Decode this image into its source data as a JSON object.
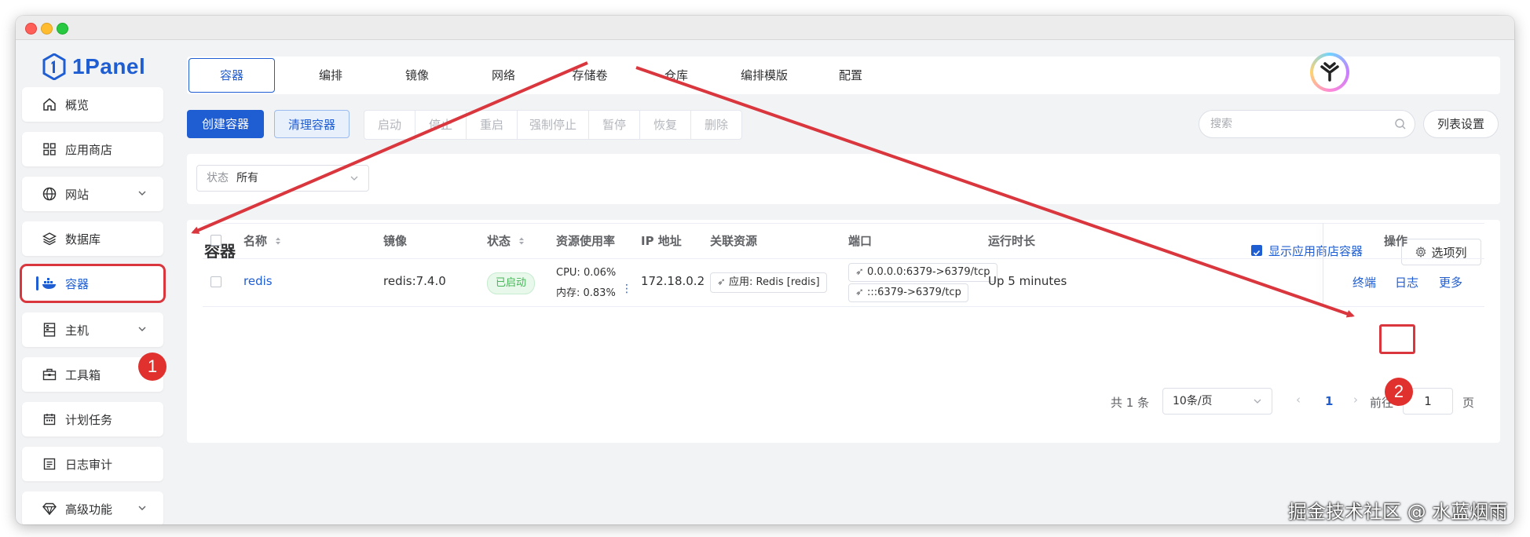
{
  "app": {
    "logo": "1Panel"
  },
  "sidebar": {
    "items": [
      {
        "label": "概览"
      },
      {
        "label": "应用商店"
      },
      {
        "label": "网站"
      },
      {
        "label": "数据库"
      },
      {
        "label": "容器"
      },
      {
        "label": "主机"
      },
      {
        "label": "工具箱"
      },
      {
        "label": "计划任务"
      },
      {
        "label": "日志审计"
      },
      {
        "label": "高级功能"
      }
    ]
  },
  "tabs": [
    "容器",
    "编排",
    "镜像",
    "网络",
    "存储卷",
    "仓库",
    "编排模版",
    "配置"
  ],
  "toolbar": {
    "create": "创建容器",
    "clean": "清理容器",
    "actions": [
      "启动",
      "停止",
      "重启",
      "强制停止",
      "暂停",
      "恢复",
      "删除"
    ],
    "search_placeholder": "搜索",
    "column_settings": "列表设置"
  },
  "filter": {
    "label": "状态",
    "value": "所有"
  },
  "card": {
    "title": "容器",
    "show_store": "显示应用商店容器",
    "options": "选项列"
  },
  "table": {
    "headers": {
      "name": "名称",
      "image": "镜像",
      "status": "状态",
      "usage": "资源使用率",
      "ip": "IP 地址",
      "related": "关联资源",
      "ports": "端口",
      "uptime": "运行时长",
      "ops": "操作"
    },
    "row": {
      "name": "redis",
      "image": "redis:7.4.0",
      "status": "已启动",
      "cpu": "CPU: 0.06%",
      "mem": "内存: 0.83%",
      "ip": "172.18.0.2",
      "related": "应用: Redis [redis]",
      "port1": "0.0.0.0:6379->6379/tcp",
      "port2": ":::6379->6379/tcp",
      "uptime": "Up 5 minutes",
      "op_terminal": "终端",
      "op_log": "日志",
      "op_more": "更多"
    }
  },
  "pagination": {
    "total": "共 1 条",
    "page_size": "10条/页",
    "current": "1",
    "goto": "前往",
    "goto_value": "1",
    "page_suffix": "页"
  },
  "annotations": {
    "m1": "1",
    "m2": "2"
  },
  "watermark": "掘金技术社区 @ 水蓝烟雨",
  "colors": {
    "primary": "#1f5dd2",
    "annotation": "#d9363e"
  }
}
